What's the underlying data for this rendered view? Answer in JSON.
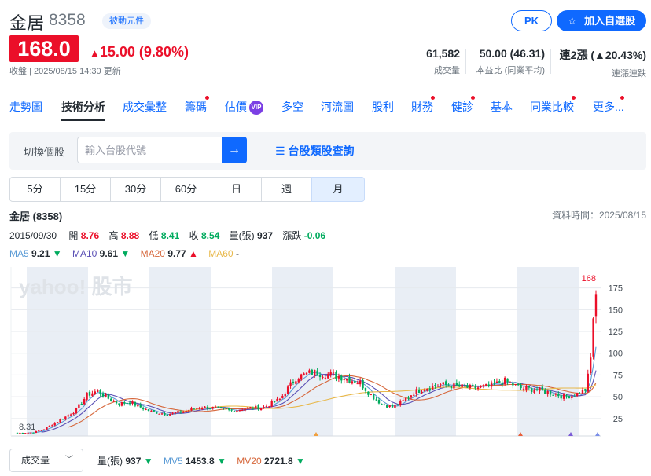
{
  "header": {
    "name": "金居",
    "code": "8358",
    "industry": "被動元件",
    "pk_label": "PK",
    "watch_label": "加入自選股",
    "price": "168.0",
    "change": "15.00 (9.80%)",
    "close_info": "收盤 | 2025/08/15 14:30 更新",
    "stats": [
      {
        "value": "61,582",
        "label": "成交量"
      },
      {
        "value": "50.00 (46.31)",
        "label": "本益比 (同業平均)"
      },
      {
        "value": "連2漲 (▲20.43%)",
        "label": "連漲連跌"
      }
    ]
  },
  "nav": {
    "tabs": [
      "走勢圖",
      "技術分析",
      "成交彙整",
      "籌碼",
      "估價",
      "多空",
      "河流圖",
      "股利",
      "財務",
      "健診",
      "基本",
      "同業比較",
      "更多..."
    ],
    "vip": "VIP"
  },
  "search": {
    "switch_label": "切換個股",
    "placeholder": "輸入台股代號",
    "category_link": "台股類股查詢"
  },
  "periods": [
    "5分",
    "15分",
    "30分",
    "60分",
    "日",
    "週",
    "月"
  ],
  "chart_info": {
    "title": "金居 (8358)",
    "data_time": "資料時間：2025/08/15",
    "date": "2015/09/30",
    "open_label": "開",
    "open": "8.76",
    "high_label": "高",
    "high": "8.88",
    "low_label": "低",
    "low": "8.41",
    "close_label": "收",
    "close": "8.54",
    "vol_label": "量(張)",
    "vol": "937",
    "chg_label": "漲跌",
    "chg": "-0.06",
    "ma": [
      {
        "name": "MA5",
        "value": "9.21",
        "arrow": "▼",
        "color": "#5b9bd5"
      },
      {
        "name": "MA10",
        "value": "9.61",
        "arrow": "▼",
        "color": "#5a4fb5"
      },
      {
        "name": "MA20",
        "value": "9.77",
        "arrow": "▲",
        "color": "#d6663a"
      },
      {
        "name": "MA60",
        "value": "-",
        "arrow": "",
        "color": "#e8b84a"
      }
    ]
  },
  "chart_data": {
    "type": "candlestick",
    "watermark": "yahoo! 股市",
    "y_ticks": [
      25,
      50,
      75,
      100,
      125,
      150,
      175
    ],
    "ylim": [
      5,
      190
    ],
    "first_value_label": "8.31",
    "last_value_label": "168",
    "start": {
      "date": "2015/09/30",
      "open": 8.76,
      "high": 8.88,
      "low": 8.41,
      "close": 8.54
    },
    "end": {
      "date": "2025/08/15",
      "close": 168.0
    },
    "colors": {
      "up": "#eb0f29",
      "down": "#00ab5e",
      "band": "#e9eef5",
      "ma5": "#5b9bd5",
      "ma10": "#5a4fb5",
      "ma20": "#d6663a",
      "ma60": "#e8b84a"
    }
  },
  "bottom": {
    "select_label": "成交量",
    "vol_label": "量(張)",
    "vol": "937",
    "vol_arrow": "▼",
    "mv5_label": "MV5",
    "mv5": "1453.8",
    "mv5_arrow": "▼",
    "mv20_label": "MV20",
    "mv20": "2721.8",
    "mv20_arrow": "▼"
  }
}
